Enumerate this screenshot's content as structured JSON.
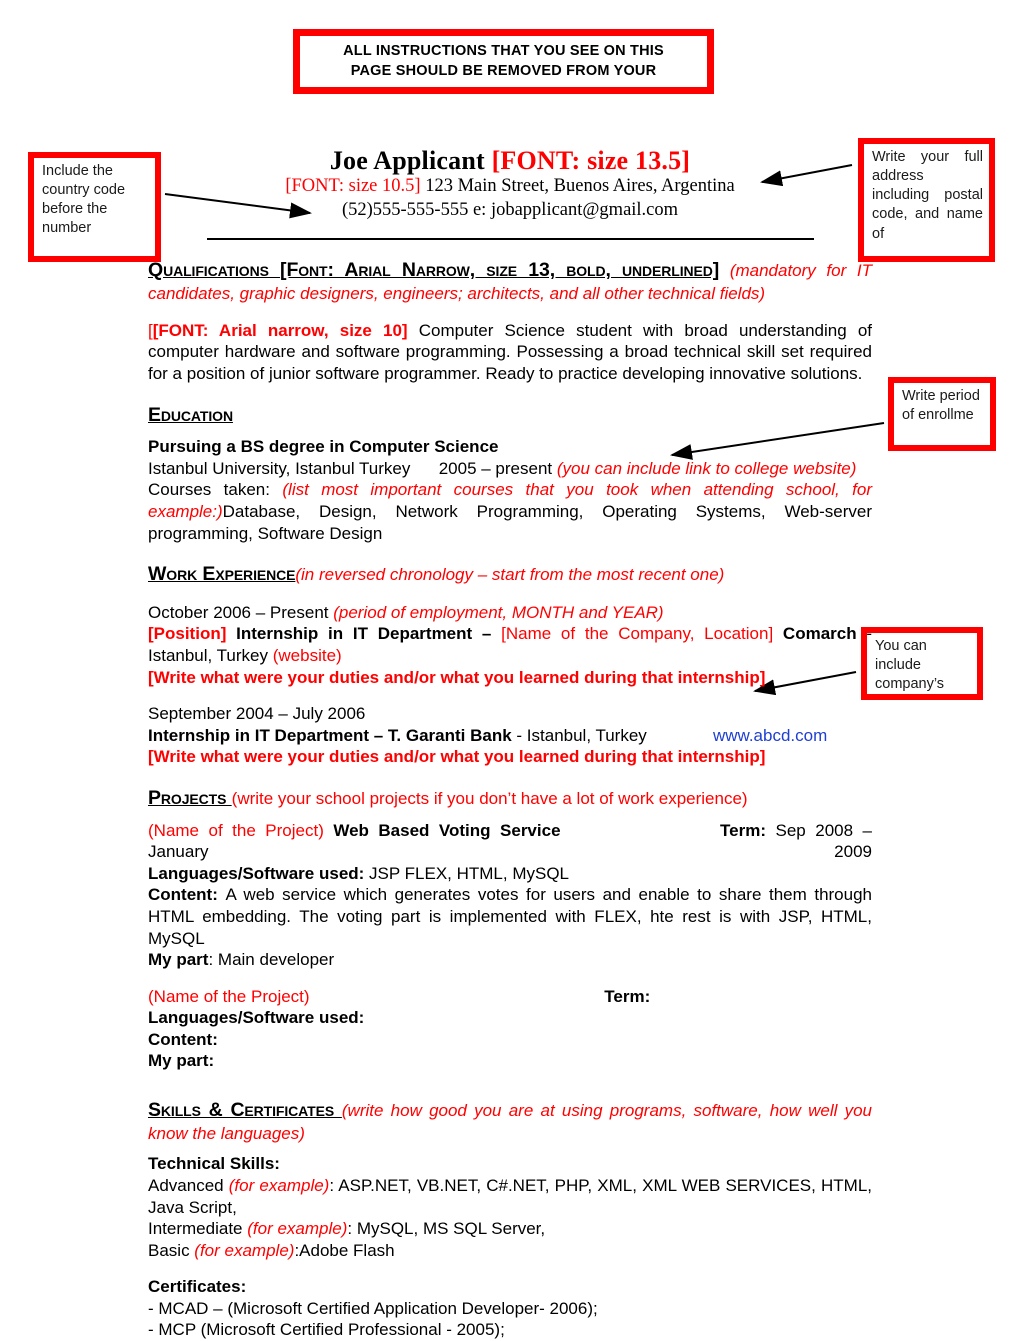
{
  "banner": {
    "line1": "ALL INSTRUCTIONS THAT YOU SEE ON THIS",
    "line2": "PAGE SHOULD BE REMOVED FROM YOUR"
  },
  "callouts": {
    "country_code": "Include the country code before the number",
    "full_address": "Write your full address including postal code, and name of",
    "enrollment_period": "Write period of enrollme",
    "company_website": "You can include company’s"
  },
  "header": {
    "name": "Joe Applicant ",
    "name_note": "[FONT: size 13.5]",
    "contact_note": "[FONT: size 10.5]",
    "address": " 123 Main Street, Buenos Aires, Argentina",
    "phone_email": "(52)555-555-555 e: jobapplicant@gmail.com"
  },
  "qualifications": {
    "heading": "Qualifications ",
    "heading_font_note": "[Font: Arial Narrow, size 13, bold, underlined]",
    "heading_note": " (mandatory for IT candidates, graphic designers, engineers; architects, and all other technical fields)",
    "body_font_note": "[FONT: Arial narrow, size 10]",
    "body_bracket_open": "[",
    "body": " Computer Science student with broad understanding of computer hardware and software programming. Possessing a broad technical skill set required for a position of junior software programmer. Ready to practice developing innovative solutions."
  },
  "education": {
    "heading": "Education",
    "degree": "Pursuing a BS degree in Computer Science",
    "school": "Istanbul University, Istanbul Turkey",
    "dates": "2005 – present",
    "school_note": "(you can include link to college website)",
    "courses_label": "Courses taken: ",
    "courses_note": "(list most important courses that you took when attending school, for example:)",
    "courses": "Database, Design, Network Programming, Operating Systems, Web-server programming, Software Design"
  },
  "work_experience": {
    "heading": "Work Experience",
    "heading_note": "(in reversed chronology – start from the most recent one)",
    "jobs": [
      {
        "dates": "October 2006 – Present ",
        "dates_note": "(period of employment, MONTH and YEAR)",
        "position_tag": "[Position] ",
        "position": "Internship in IT Department – ",
        "company_tag": "[Name of the Company, Location] ",
        "company": "Comarch",
        "location": " - Istanbul, Turkey ",
        "website_note": "(website)",
        "duties": "[Write what were your duties and/or what you learned during that internship]"
      },
      {
        "dates": "September 2004 – July 2006",
        "position": "Internship in IT Department – T. Garanti Bank",
        "location": " - Istanbul, Turkey",
        "website": "www.abcd.com",
        "duties": "[Write what were your duties and/or what you learned during that internship]"
      }
    ]
  },
  "projects": {
    "heading": "Projects ",
    "heading_note": "(write your school projects if you don’t have a lot of work experience)",
    "items": [
      {
        "name_note": "(Name of the Project) ",
        "name": "Web Based Voting Service",
        "term_label": "Term:",
        "term_value": " Sep 2008 – January 2009",
        "languages_label": "Languages/Software used: ",
        "languages_value": "JSP FLEX, HTML, MySQL",
        "content_label": "Content: ",
        "content_value": "A web service which generates votes for users and enable to share them through HTML embedding. The voting part is implemented with FLEX, hte rest is with JSP, HTML, MySQL",
        "mypart_label": "My part",
        "mypart_value": ": Main developer"
      },
      {
        "name_note": "(Name of the Project)",
        "name": "",
        "term_label": "Term:",
        "term_value": "",
        "languages_label": "Languages/Software used:",
        "languages_value": "",
        "content_label": "Content:",
        "content_value": "",
        "mypart_label": "My part:",
        "mypart_value": ""
      }
    ]
  },
  "skills": {
    "heading": "Skills & Certificates ",
    "heading_note": "(write how good you are at using programs, software, how well you know the languages)",
    "technical_label": "Technical Skills:",
    "levels": [
      {
        "level": "Advanced ",
        "note": "(for example)",
        "value": ": ASP.NET, VB.NET, C#.NET, PHP, XML, XML WEB SERVICES, HTML, Java Script,"
      },
      {
        "level": "Intermediate ",
        "note": "(for example)",
        "value": ": MySQL, MS SQL Server,"
      },
      {
        "level": "Basic ",
        "note": "(for example)",
        "value": ":Adobe Flash"
      }
    ],
    "certificates_label": "Certificates:",
    "certificates": [
      "- MCAD – (Microsoft Certified Application Developer- 2006);",
      "- MCP (Microsoft Certified Professional - 2005);"
    ]
  },
  "colors": {
    "accent_red": "#ff0000",
    "link_blue": "#1f3fd0",
    "text_black": "#000000"
  }
}
